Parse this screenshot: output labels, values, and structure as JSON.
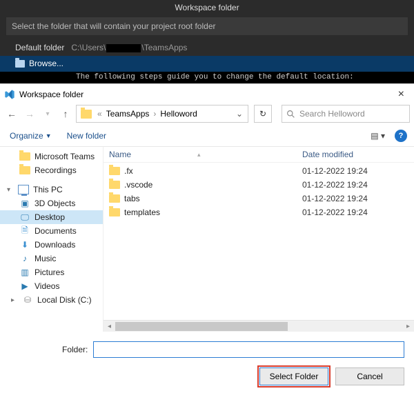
{
  "vsc": {
    "title": "Workspace folder",
    "prompt": "Select the folder that will contain your project root folder",
    "default_label": "Default folder",
    "default_path_prefix": "C:\\Users\\",
    "default_path_suffix": "\\TeamsApps",
    "browse": "Browse...",
    "hint": "The following steps guide you to change the default location:"
  },
  "dialog": {
    "title": "Workspace folder",
    "breadcrumb": {
      "a": "TeamsApps",
      "b": "Helloword"
    },
    "search_placeholder": "Search Helloword",
    "organize": "Organize",
    "newfolder": "New folder",
    "columns": {
      "name": "Name",
      "date": "Date modified"
    },
    "rows": [
      {
        "name": ".fx",
        "date": "01-12-2022 19:24"
      },
      {
        "name": ".vscode",
        "date": "01-12-2022 19:24"
      },
      {
        "name": "tabs",
        "date": "01-12-2022 19:24"
      },
      {
        "name": "templates",
        "date": "01-12-2022 19:24"
      }
    ],
    "tree": {
      "mteams": "Microsoft Teams",
      "recordings": "Recordings",
      "thispc": "This PC",
      "obj3d": "3D Objects",
      "desktop": "Desktop",
      "documents": "Documents",
      "downloads": "Downloads",
      "music": "Music",
      "pictures": "Pictures",
      "videos": "Videos",
      "localdisk": "Local Disk (C:)"
    },
    "folder_label": "Folder:",
    "folder_value": "",
    "select": "Select Folder",
    "cancel": "Cancel"
  }
}
